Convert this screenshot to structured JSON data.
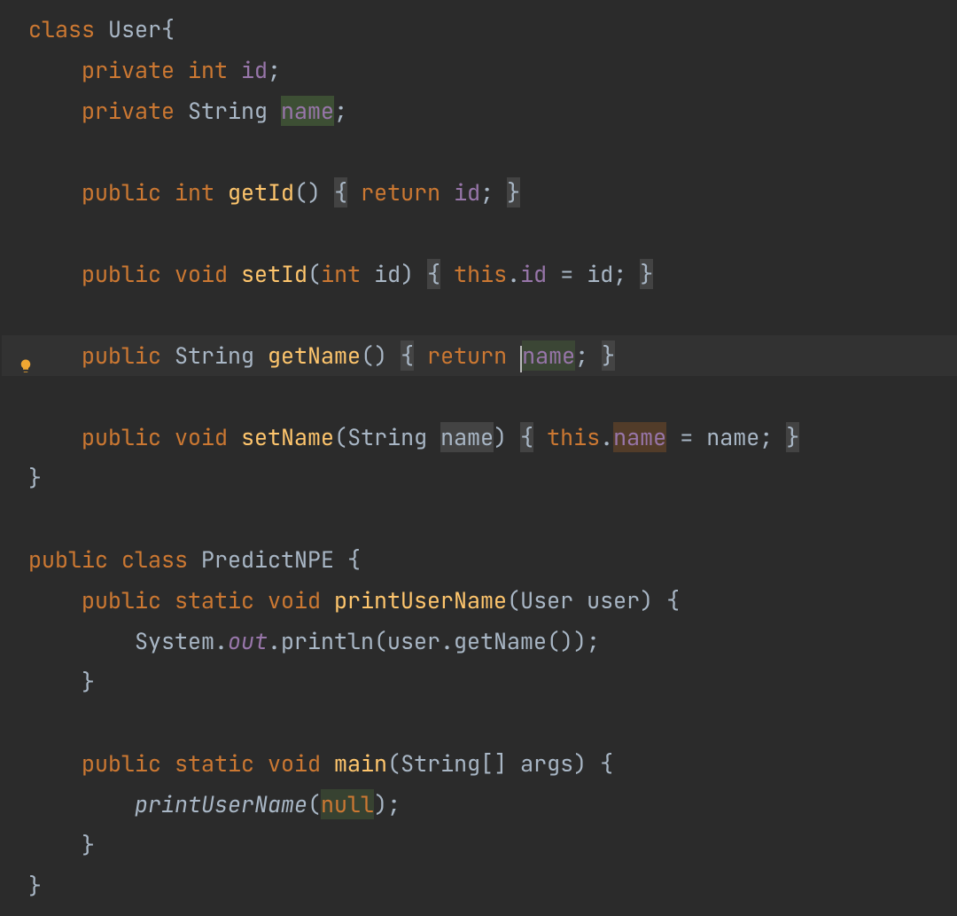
{
  "code": {
    "lines": [
      {
        "indent": 0,
        "tokens": [
          {
            "t": "class ",
            "c": "tok-kw"
          },
          {
            "t": "User",
            "c": "tok-type"
          },
          {
            "t": "{",
            "c": "tok-brace"
          }
        ]
      },
      {
        "indent": 1,
        "tokens": [
          {
            "t": "private int ",
            "c": "tok-kw"
          },
          {
            "t": "id",
            "c": "tok-field"
          },
          {
            "t": ";",
            "c": "tok-punct"
          }
        ]
      },
      {
        "indent": 1,
        "tokens": [
          {
            "t": "private ",
            "c": "tok-kw"
          },
          {
            "t": "String ",
            "c": "tok-type"
          },
          {
            "t": "name",
            "c": "tok-field",
            "hl": "hl-green-strong"
          },
          {
            "t": ";",
            "c": "tok-punct"
          }
        ]
      },
      {
        "indent": 0,
        "blank": true
      },
      {
        "indent": 1,
        "tokens": [
          {
            "t": "public int ",
            "c": "tok-kw"
          },
          {
            "t": "getId",
            "c": "tok-method"
          },
          {
            "t": "() ",
            "c": "tok-punct"
          },
          {
            "t": "{",
            "c": "tok-brace",
            "hl": "hl-dark"
          },
          {
            "t": " ",
            "c": ""
          },
          {
            "t": "return ",
            "c": "tok-kw"
          },
          {
            "t": "id",
            "c": "tok-field"
          },
          {
            "t": "; ",
            "c": "tok-punct"
          },
          {
            "t": "}",
            "c": "tok-brace",
            "hl": "hl-dark"
          }
        ]
      },
      {
        "indent": 0,
        "blank": true
      },
      {
        "indent": 1,
        "tokens": [
          {
            "t": "public void ",
            "c": "tok-kw"
          },
          {
            "t": "setId",
            "c": "tok-method"
          },
          {
            "t": "(",
            "c": "tok-punct"
          },
          {
            "t": "int ",
            "c": "tok-kw"
          },
          {
            "t": "id",
            "c": "tok-ident"
          },
          {
            "t": ") ",
            "c": "tok-punct"
          },
          {
            "t": "{",
            "c": "tok-brace",
            "hl": "hl-dark"
          },
          {
            "t": " ",
            "c": ""
          },
          {
            "t": "this",
            "c": "tok-kw"
          },
          {
            "t": ".",
            "c": "tok-punct"
          },
          {
            "t": "id",
            "c": "tok-field"
          },
          {
            "t": " = id; ",
            "c": "tok-punct"
          },
          {
            "t": "}",
            "c": "tok-brace",
            "hl": "hl-dark"
          }
        ]
      },
      {
        "indent": 0,
        "blank": true
      },
      {
        "indent": 1,
        "active": true,
        "bulb": true,
        "tokens": [
          {
            "t": "public ",
            "c": "tok-kw"
          },
          {
            "t": "String ",
            "c": "tok-type"
          },
          {
            "t": "getName",
            "c": "tok-method"
          },
          {
            "t": "() ",
            "c": "tok-punct"
          },
          {
            "t": "{",
            "c": "tok-brace",
            "hl": "hl-dark"
          },
          {
            "t": " ",
            "c": ""
          },
          {
            "t": "return ",
            "c": "tok-kw"
          },
          {
            "caret": true
          },
          {
            "t": "name",
            "c": "tok-field",
            "hl": "hl-green-weak"
          },
          {
            "t": "; ",
            "c": "tok-punct"
          },
          {
            "t": "}",
            "c": "tok-brace",
            "hl": "hl-dark"
          }
        ]
      },
      {
        "indent": 0,
        "blank": true
      },
      {
        "indent": 1,
        "tokens": [
          {
            "t": "public void ",
            "c": "tok-kw"
          },
          {
            "t": "setName",
            "c": "tok-method"
          },
          {
            "t": "(",
            "c": "tok-punct"
          },
          {
            "t": "String ",
            "c": "tok-type"
          },
          {
            "t": "name",
            "c": "tok-ident",
            "hl": "hl-dark"
          },
          {
            "t": ") ",
            "c": "tok-punct"
          },
          {
            "t": "{",
            "c": "tok-brace",
            "hl": "hl-dark"
          },
          {
            "t": " ",
            "c": ""
          },
          {
            "t": "this",
            "c": "tok-kw"
          },
          {
            "t": ".",
            "c": "tok-punct"
          },
          {
            "t": "name",
            "c": "tok-field",
            "hl": "hl-brown"
          },
          {
            "t": " = name; ",
            "c": "tok-punct"
          },
          {
            "t": "}",
            "c": "tok-brace",
            "hl": "hl-dark"
          }
        ]
      },
      {
        "indent": 0,
        "tokens": [
          {
            "t": "}",
            "c": "tok-brace"
          }
        ]
      },
      {
        "indent": 0,
        "blank": true
      },
      {
        "indent": 0,
        "tokens": [
          {
            "t": "public class ",
            "c": "tok-kw"
          },
          {
            "t": "PredictNPE ",
            "c": "tok-type"
          },
          {
            "t": "{",
            "c": "tok-brace"
          }
        ]
      },
      {
        "indent": 1,
        "tokens": [
          {
            "t": "public static void ",
            "c": "tok-kw"
          },
          {
            "t": "printUserName",
            "c": "tok-method"
          },
          {
            "t": "(",
            "c": "tok-punct"
          },
          {
            "t": "User user",
            "c": "tok-type"
          },
          {
            "t": ") {",
            "c": "tok-punct"
          }
        ]
      },
      {
        "indent": 2,
        "tokens": [
          {
            "t": "System.",
            "c": "tok-type"
          },
          {
            "t": "out",
            "c": "tok-static"
          },
          {
            "t": ".println(user.getName());",
            "c": "tok-punct"
          }
        ]
      },
      {
        "indent": 1,
        "tokens": [
          {
            "t": "}",
            "c": "tok-brace"
          }
        ]
      },
      {
        "indent": 0,
        "blank": true
      },
      {
        "indent": 1,
        "tokens": [
          {
            "t": "public static void ",
            "c": "tok-kw"
          },
          {
            "t": "main",
            "c": "tok-method"
          },
          {
            "t": "(",
            "c": "tok-punct"
          },
          {
            "t": "String[] args",
            "c": "tok-type"
          },
          {
            "t": ") {",
            "c": "tok-punct"
          }
        ]
      },
      {
        "indent": 2,
        "tokens": [
          {
            "t": "printUserName",
            "c": "tok-ident tok-call-italic"
          },
          {
            "t": "(",
            "c": "tok-punct"
          },
          {
            "t": "null",
            "c": "tok-null",
            "hl": "hl-green-weak"
          },
          {
            "t": ");",
            "c": "tok-punct"
          }
        ]
      },
      {
        "indent": 1,
        "tokens": [
          {
            "t": "}",
            "c": "tok-brace"
          }
        ]
      },
      {
        "indent": 0,
        "tokens": [
          {
            "t": "}",
            "c": "tok-brace"
          }
        ]
      }
    ]
  },
  "indentUnit": "    ",
  "gutterLeftPad": "  "
}
